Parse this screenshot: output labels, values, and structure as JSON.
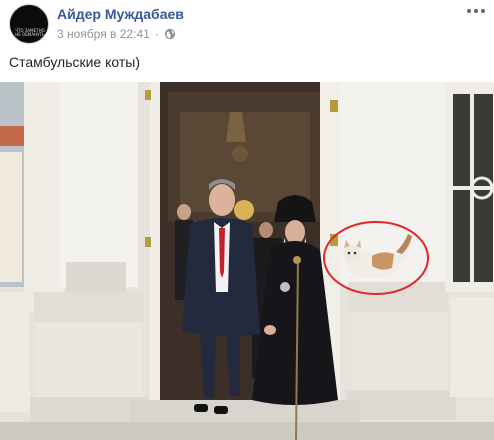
{
  "post": {
    "author": "Айдер Муждабаев",
    "timestamp": "3 ноября в 22:41",
    "separator": "·",
    "caption": "Стамбульские коты)",
    "avatar_text": "ЧТО ЗАМЕТНО НЕ ОБМАНУТЬ"
  },
  "icons": {
    "privacy": "globe-icon",
    "menu": "more-horizontal-icon"
  },
  "colors": {
    "author_link": "#385898",
    "meta_text": "#90949c",
    "highlight_circle": "#e0262b"
  }
}
